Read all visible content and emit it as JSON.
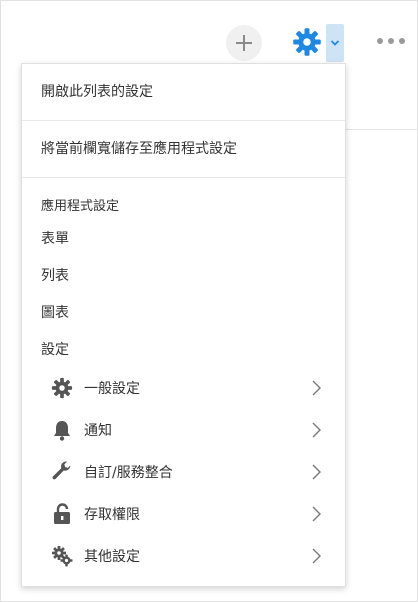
{
  "toolbar": {
    "add_icon": "plus-icon",
    "settings_icon": "gear-icon",
    "caret_icon": "chevron-down-icon",
    "more_icon": "ellipsis-icon",
    "accent_color": "#1e88e5"
  },
  "menu": {
    "open_list_settings": "開啟此列表的設定",
    "save_columns": "將當前欄寬儲存至應用程式設定",
    "app_settings_header": "應用程式設定",
    "links": [
      "表單",
      "列表",
      "圖表",
      "設定"
    ],
    "sub_items": [
      {
        "label": "一般設定",
        "icon": "gear-icon"
      },
      {
        "label": "通知",
        "icon": "bell-icon"
      },
      {
        "label": "自訂/服務整合",
        "icon": "wrench-icon"
      },
      {
        "label": "存取權限",
        "icon": "unlock-icon"
      },
      {
        "label": "其他設定",
        "icon": "gears-icon"
      }
    ]
  }
}
